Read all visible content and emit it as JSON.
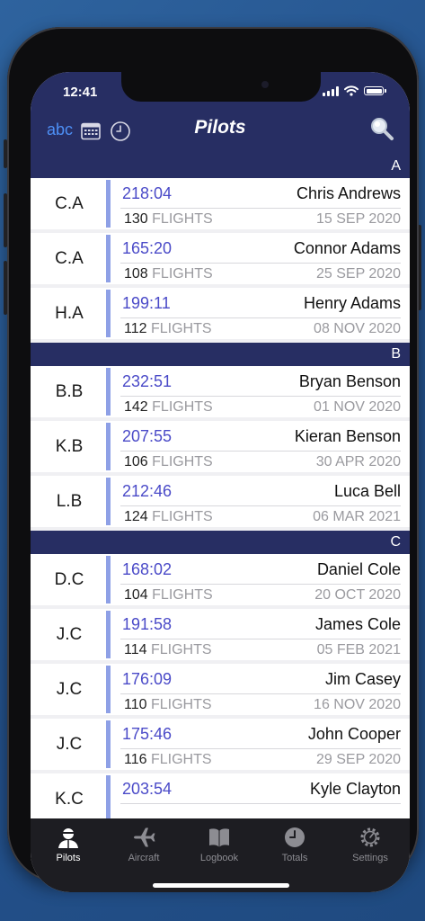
{
  "status": {
    "time": "12:41"
  },
  "header": {
    "sort_abc_label": "abc",
    "title": "Pilots",
    "icons": [
      "calendar-icon",
      "clock-icon",
      "search-icon"
    ]
  },
  "sections": [
    {
      "letter": "A",
      "rows": [
        {
          "initials": "C.A",
          "hours": "218:04",
          "name": "Chris Andrews",
          "flights": "130",
          "flights_label": "FLIGHTS",
          "date": "15 SEP 2020"
        },
        {
          "initials": "C.A",
          "hours": "165:20",
          "name": "Connor Adams",
          "flights": "108",
          "flights_label": "FLIGHTS",
          "date": "25 SEP 2020"
        },
        {
          "initials": "H.A",
          "hours": "199:11",
          "name": "Henry Adams",
          "flights": "112",
          "flights_label": "FLIGHTS",
          "date": "08 NOV 2020"
        }
      ]
    },
    {
      "letter": "B",
      "rows": [
        {
          "initials": "B.B",
          "hours": "232:51",
          "name": "Bryan Benson",
          "flights": "142",
          "flights_label": "FLIGHTS",
          "date": "01 NOV 2020"
        },
        {
          "initials": "K.B",
          "hours": "207:55",
          "name": "Kieran Benson",
          "flights": "106",
          "flights_label": "FLIGHTS",
          "date": "30 APR 2020"
        },
        {
          "initials": "L.B",
          "hours": "212:46",
          "name": "Luca Bell",
          "flights": "124",
          "flights_label": "FLIGHTS",
          "date": "06 MAR 2021"
        }
      ]
    },
    {
      "letter": "C",
      "rows": [
        {
          "initials": "D.C",
          "hours": "168:02",
          "name": "Daniel Cole",
          "flights": "104",
          "flights_label": "FLIGHTS",
          "date": "20 OCT 2020"
        },
        {
          "initials": "J.C",
          "hours": "191:58",
          "name": "James Cole",
          "flights": "114",
          "flights_label": "FLIGHTS",
          "date": "05 FEB 2021"
        },
        {
          "initials": "J.C",
          "hours": "176:09",
          "name": "Jim Casey",
          "flights": "110",
          "flights_label": "FLIGHTS",
          "date": "16 NOV 2020"
        },
        {
          "initials": "J.C",
          "hours": "175:46",
          "name": "John Cooper",
          "flights": "116",
          "flights_label": "FLIGHTS",
          "date": "29 SEP 2020"
        },
        {
          "initials": "K.C",
          "hours": "203:54",
          "name": "Kyle Clayton",
          "flights": "",
          "flights_label": "",
          "date": ""
        }
      ]
    }
  ],
  "tabs": [
    {
      "label": "Pilots",
      "icon": "pilot-icon",
      "active": true
    },
    {
      "label": "Aircraft",
      "icon": "airplane-icon",
      "active": false
    },
    {
      "label": "Logbook",
      "icon": "book-icon",
      "active": false
    },
    {
      "label": "Totals",
      "icon": "clock-icon",
      "active": false
    },
    {
      "label": "Settings",
      "icon": "gear-icon",
      "active": false
    }
  ],
  "colors": {
    "nav_bg": "#272e63",
    "accent_blue": "#4a4ac8",
    "row_bar": "#8ea0e6",
    "tabbar_bg": "#1d1d22"
  }
}
